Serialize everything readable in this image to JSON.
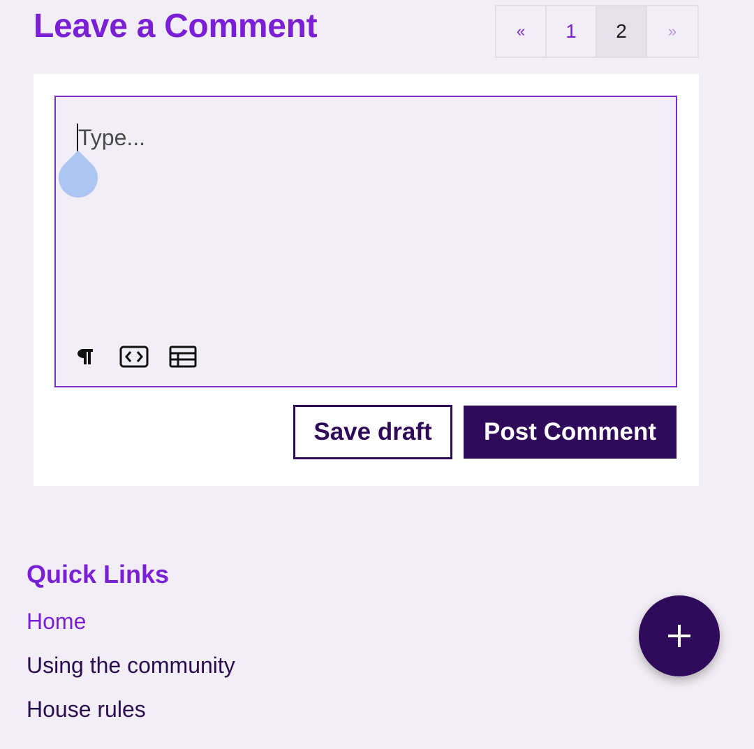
{
  "header": {
    "title": "Leave a Comment"
  },
  "pagination": {
    "prev": "«",
    "pages": [
      "1",
      "2"
    ],
    "current": "2",
    "next": "»"
  },
  "editor": {
    "placeholder": "Type...",
    "toolbar": [
      {
        "icon": "paragraph-icon"
      },
      {
        "icon": "code-icon"
      },
      {
        "icon": "table-icon"
      }
    ]
  },
  "actions": {
    "save_label": "Save draft",
    "post_label": "Post Comment"
  },
  "quick_links": {
    "title": "Quick Links",
    "items": [
      "Home",
      "Using the community",
      "House rules"
    ]
  },
  "fab": {
    "icon": "plus-icon"
  },
  "colors": {
    "accent": "#7a1fd6",
    "primary_dark": "#2f0a5a",
    "background": "#f2eef5",
    "selection_handle": "#aec6f4"
  }
}
